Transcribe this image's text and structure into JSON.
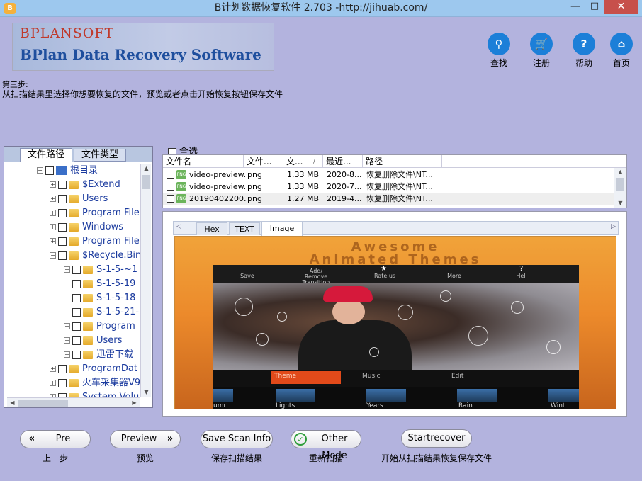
{
  "window": {
    "title": "B计划数据恢复软件 2.703 -http://jihuab.com/",
    "app_icon": "app-icon",
    "min": "—",
    "max": "□",
    "close": "✕"
  },
  "logo": {
    "top": "BPLANSOFT",
    "bottom": "BPlan Data Recovery Software"
  },
  "top_buttons": [
    {
      "icon": "search-icon",
      "glyph": "⚲",
      "label": "查找"
    },
    {
      "icon": "cart-icon",
      "glyph": "🛒",
      "label": "注册"
    },
    {
      "icon": "help-icon",
      "glyph": "?",
      "label": "帮助"
    },
    {
      "icon": "home-icon",
      "glyph": "⌂",
      "label": "首页"
    }
  ],
  "step": {
    "title": "第三步:",
    "desc": "从扫描结果里选择你想要恢复的文件，预览或者点击开始恢复按钮保存文件"
  },
  "left_tabs": {
    "path": "文件路径",
    "type": "文件类型"
  },
  "tree": [
    {
      "label": "根目录",
      "level": 0,
      "exp": "−",
      "kind": "drive"
    },
    {
      "label": "$Extend",
      "level": 1,
      "exp": "+",
      "kind": "folder"
    },
    {
      "label": "Users",
      "level": 1,
      "exp": "+",
      "kind": "folder"
    },
    {
      "label": "Program File",
      "level": 1,
      "exp": "+",
      "kind": "folder"
    },
    {
      "label": "Windows",
      "level": 1,
      "exp": "+",
      "kind": "folder"
    },
    {
      "label": "Program File",
      "level": 1,
      "exp": "+",
      "kind": "folder"
    },
    {
      "label": "$Recycle.Bin",
      "level": 1,
      "exp": "−",
      "kind": "folder"
    },
    {
      "label": "S-1-5-~1",
      "level": 2,
      "exp": "+",
      "kind": "folder"
    },
    {
      "label": "S-1-5-19",
      "level": 2,
      "exp": "",
      "kind": "folder"
    },
    {
      "label": "S-1-5-18",
      "level": 2,
      "exp": "",
      "kind": "folder"
    },
    {
      "label": "S-1-5-21-",
      "level": 2,
      "exp": "",
      "kind": "folder"
    },
    {
      "label": "Program",
      "level": 2,
      "exp": "+",
      "kind": "folder"
    },
    {
      "label": "Users",
      "level": 2,
      "exp": "+",
      "kind": "folder"
    },
    {
      "label": "迅雷下载",
      "level": 2,
      "exp": "+",
      "kind": "folder"
    },
    {
      "label": "ProgramDat",
      "level": 1,
      "exp": "+",
      "kind": "folder"
    },
    {
      "label": "火车采集器V9",
      "level": 1,
      "exp": "+",
      "kind": "folder"
    },
    {
      "label": "System Volu",
      "level": 1,
      "exp": "+",
      "kind": "folder"
    }
  ],
  "select_all": "全选",
  "list": {
    "headers": [
      "文件名",
      "文件...",
      "文...",
      "最近...",
      "路径"
    ],
    "sort_indicator": "/",
    "rows": [
      {
        "name": "video-preview...",
        "type": "png",
        "size": "1.33 MB",
        "date": "2020-8...",
        "path": "恢复删除文件\\NT..."
      },
      {
        "name": "video-preview...",
        "type": "png",
        "size": "1.33 MB",
        "date": "2020-7...",
        "path": "恢复删除文件\\NT..."
      },
      {
        "name": "20190402200...",
        "type": "png",
        "size": "1.27 MB",
        "date": "2019-4...",
        "path": "恢复删除文件\\NT..."
      }
    ]
  },
  "preview": {
    "tabs": [
      "Hex",
      "TEXT",
      "Image"
    ],
    "image": {
      "title1": "Awesome",
      "title2": "Animated Themes",
      "menu": [
        "Save",
        "Add/\nRemove\nTransition",
        "Rate us",
        "More",
        "Hel"
      ],
      "tabs": [
        "Theme",
        "Music",
        "Edit"
      ],
      "thumbs": [
        "umr",
        "Lights",
        "Years",
        "Rain",
        "Wint"
      ]
    }
  },
  "bottom": [
    {
      "label": "Pre",
      "sub": "上一步",
      "arrow": "«"
    },
    {
      "label": "Preview",
      "sub": "预览",
      "arrow": "»"
    },
    {
      "label": "Save Scan Info",
      "sub": "保存扫描结果"
    },
    {
      "label": "Other Mode",
      "sub": "重新扫描",
      "arrow": "✓"
    },
    {
      "label": "Startrecover",
      "sub": "开始从扫描结果恢复保存文件"
    }
  ]
}
